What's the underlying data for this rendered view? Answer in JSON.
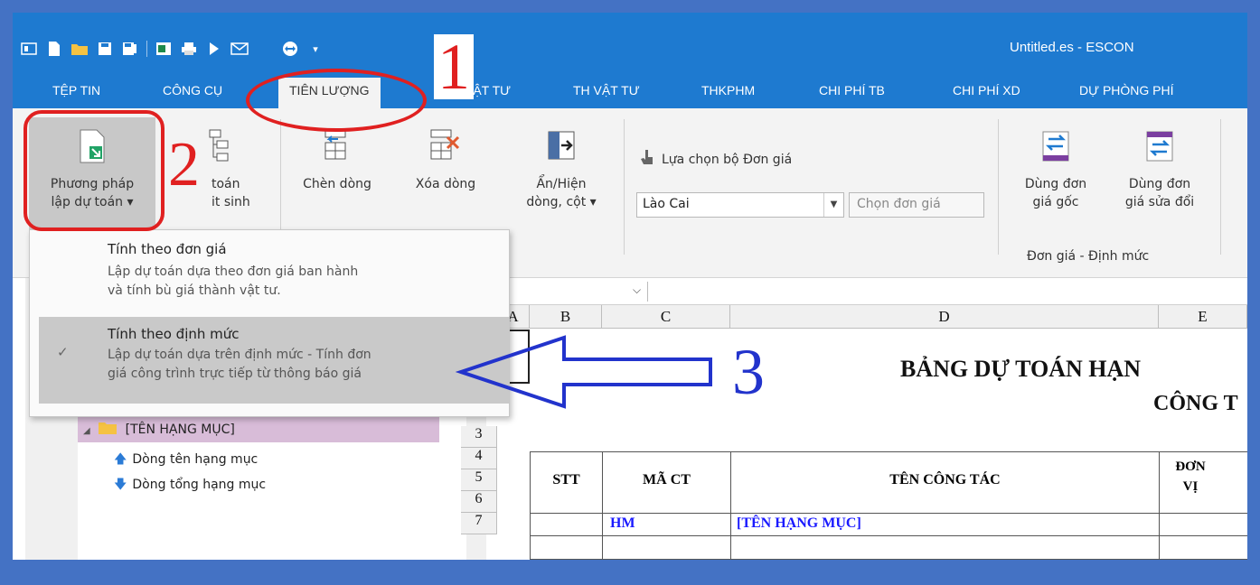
{
  "window": {
    "title": "Untitled.es - ESCON"
  },
  "tabs": [
    {
      "label": "TỆP TIN"
    },
    {
      "label": "CÔNG CỤ"
    },
    {
      "label": "TIÊN LƯỢNG"
    },
    {
      "label": "VẬT TƯ"
    },
    {
      "label": "TH VẬT TƯ"
    },
    {
      "label": "THKPHM"
    },
    {
      "label": "CHI PHÍ TB"
    },
    {
      "label": "CHI PHÍ XD"
    },
    {
      "label": "DỰ PHÒNG PHÍ"
    }
  ],
  "ribbon": {
    "phuong_phap_line1": "Phương pháp",
    "phuong_phap_line2": "lập dự toán ▾",
    "du_toan_line1": "toán",
    "du_toan_line2": "it sinh",
    "chen_dong": "Chèn dòng",
    "xoa_dong": "Xóa dòng",
    "an_hien_line1": "Ẩn/Hiện",
    "an_hien_line2": "dòng, cột ▾",
    "lua_chon": "Lựa chọn bộ Đơn giá",
    "location_value": "Lào Cai",
    "chon_don_gia": "Chọn đơn giá",
    "dung_goc_line1": "Dùng đơn",
    "dung_goc_line2": "giá gốc",
    "dung_sua_line1": "Dùng đơn",
    "dung_sua_line2": "giá sửa đổi",
    "group_caption": "Đơn giá - Định mức"
  },
  "menu": {
    "item1_title": "Tính theo đơn giá",
    "item1_desc1": "Lập dự toán dựa theo đơn giá ban hành",
    "item1_desc2": "và tính bù giá thành vật tư.",
    "item2_title": "Tính theo định mức",
    "item2_desc1": "Lập dự toán dựa trên định mức - Tính đơn",
    "item2_desc2": "giá công trình trực tiếp từ thông báo giá",
    "item2_check": "✓"
  },
  "tree": {
    "root": "[TÊN HẠNG MỤC]",
    "item1": "Dòng tên hạng mục",
    "item2": "Dòng tổng hạng mục"
  },
  "sheet": {
    "columns": [
      "A",
      "B",
      "C",
      "D",
      "E"
    ],
    "rows": [
      "3",
      "4",
      "5",
      "6",
      "7"
    ],
    "title1": "BẢNG DỰ TOÁN HẠN",
    "title2": "CÔNG T",
    "hdr_stt": "STT",
    "hdr_mact": "MÃ CT",
    "hdr_tencongtac": "TÊN CÔNG TÁC",
    "hdr_donvi_1": "ĐƠN",
    "hdr_donvi_2": "VỊ",
    "row6_code": "HM",
    "row6_name": "[TÊN HẠNG MỤC]"
  },
  "annotations": {
    "n1": "1",
    "n2": "2",
    "n3": "3"
  },
  "colors": {
    "accent": "#1e7ad0",
    "frame": "#4472c4",
    "annotation_red": "#e02020",
    "arrow_blue": "#2233cc",
    "link_blue": "#1a1aff"
  }
}
